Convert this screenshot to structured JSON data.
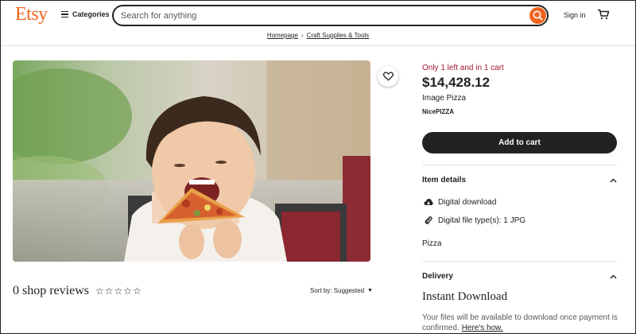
{
  "header": {
    "logo": "Etsy",
    "categories_label": "Categories",
    "search_placeholder": "Search for anything",
    "signin_label": "Sign in"
  },
  "breadcrumb": {
    "items": [
      "Homepage",
      "Craft Supplies & Tools"
    ],
    "separator": "›"
  },
  "listing": {
    "stock_notice": "Only 1 left and in 1 cart",
    "price": "$14,428.12",
    "title": "Image Pizza",
    "shop_name": "NicePIZZA",
    "add_to_cart_label": "Add to cart"
  },
  "item_details": {
    "heading": "Item details",
    "digital_download": "Digital download",
    "file_types": "Digital file type(s): 1 JPG",
    "description": "Pizza"
  },
  "delivery": {
    "heading": "Delivery",
    "instant_title": "Instant Download",
    "note": "Your files will be available to download once payment is confirmed.",
    "link": "Here's how."
  },
  "reviews": {
    "title": "0 shop reviews",
    "stars": "☆☆☆☆☆",
    "rating": 0,
    "sort_label": "Sort by: Suggested",
    "sort_arrow": "▼"
  },
  "colors": {
    "brand": "#f1641e",
    "stock_alert": "#a61a2e",
    "button": "#222222"
  },
  "icons": [
    "hamburger-icon",
    "search-icon",
    "cart-icon",
    "heart-icon",
    "download-cloud-icon",
    "paperclip-icon",
    "chevron-up-icon",
    "sort-caret-icon"
  ]
}
